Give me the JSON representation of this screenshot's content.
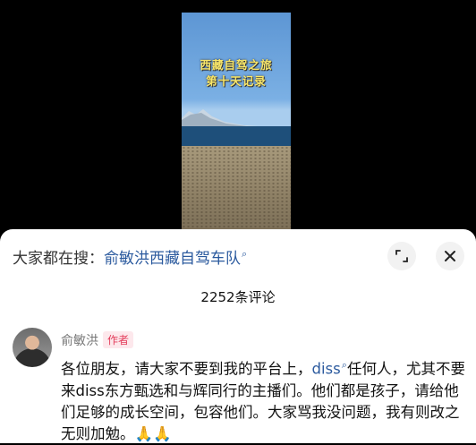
{
  "video": {
    "overlay_line1": "西藏自驾之旅",
    "overlay_line2": "第十天记录"
  },
  "search": {
    "prefix": "大家都在搜：",
    "query": "俞敏洪西藏自驾车队",
    "icon": "search-icon"
  },
  "header_icons": {
    "expand": "expand-icon",
    "close": "close-icon"
  },
  "comments_header": {
    "count_label": "2252条评论"
  },
  "comment": {
    "author": "俞敏洪",
    "badge": "作者",
    "text_part1": "各位朋友，请大家不要到我的平台上，",
    "link_text": "diss",
    "text_part2": "任何人，尤其不要来diss东方甄选和与辉同行的主播们。他们都是孩子，请给他们足够的成长空间，包容他们。大家骂我没问题，我有则改之无则加勉。",
    "emojis": "🙏🙏"
  }
}
